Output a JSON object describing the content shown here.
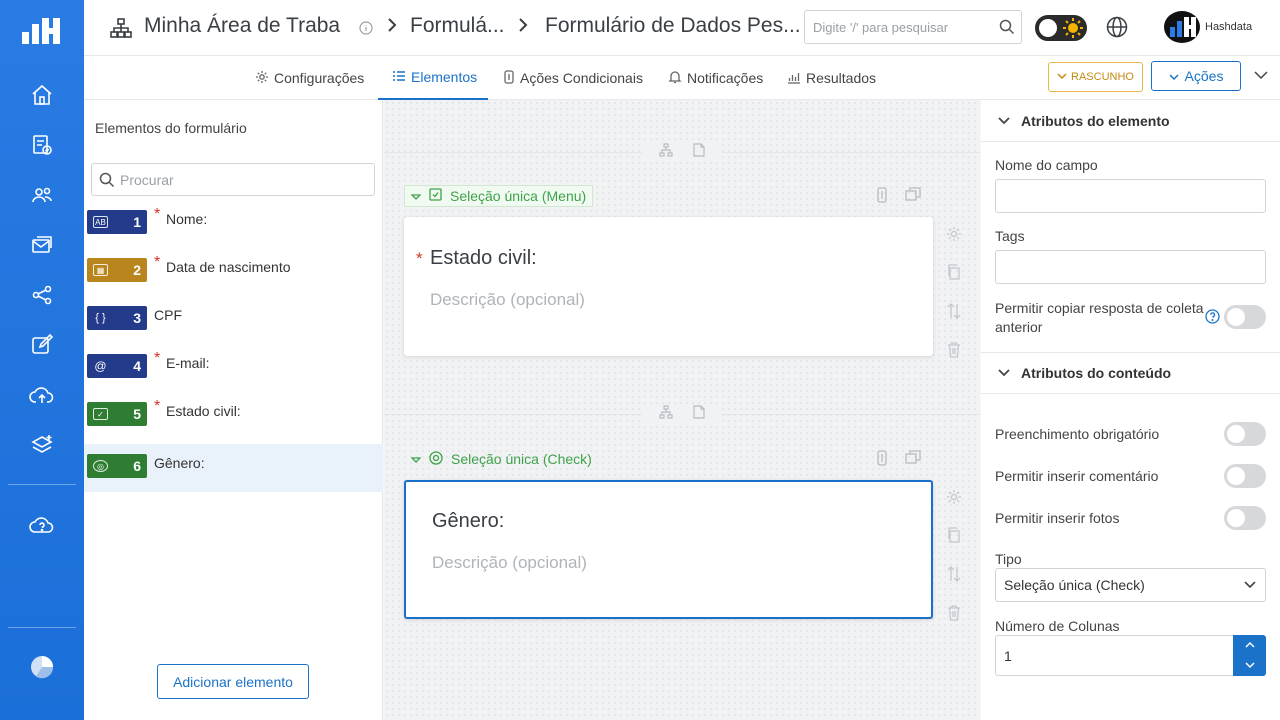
{
  "topbar": {
    "workspace": "Minha Área de Traba",
    "crumb_1": "Formulá...",
    "crumb_2": "Formulário de Dados Pes...",
    "search_placeholder": "Digite '/' para pesquisar",
    "user_name": "Hashdata"
  },
  "tabs": [
    {
      "label": "Configurações",
      "icon": "gear-icon"
    },
    {
      "label": "Elementos",
      "icon": "list-icon"
    },
    {
      "label": "Ações Condicionais",
      "icon": "conditional-icon"
    },
    {
      "label": "Notificações",
      "icon": "bell-icon"
    },
    {
      "label": "Resultados",
      "icon": "chart-icon"
    }
  ],
  "toolbar": {
    "draft_label": "RASCUNHO",
    "actions_label": "Ações"
  },
  "left_panel": {
    "title": "Elementos do formulário",
    "search_placeholder": "Procurar",
    "add_button": "Adicionar elemento",
    "elements": [
      {
        "number": "1",
        "label": "Nome:",
        "required": true,
        "color": "#243a8a",
        "icon": "AB"
      },
      {
        "number": "2",
        "label": "Data de nascimento",
        "required": true,
        "color": "#b8861c",
        "icon": "▦"
      },
      {
        "number": "3",
        "label": "CPF",
        "required": false,
        "color": "#243a8a",
        "icon": "{ }"
      },
      {
        "number": "4",
        "label": "E-mail:",
        "required": true,
        "color": "#243a8a",
        "icon": "@"
      },
      {
        "number": "5",
        "label": "Estado civil:",
        "required": true,
        "color": "#2e7d32",
        "icon": "✓"
      },
      {
        "number": "6",
        "label": "Gênero:",
        "required": false,
        "color": "#2e7d32",
        "icon": "◎"
      }
    ]
  },
  "canvas": {
    "card_1": {
      "type": "Seleção única (Menu)",
      "title": "Estado civil:",
      "description": "Descrição (opcional)"
    },
    "card_2": {
      "type": "Seleção única (Check)",
      "title": "Gênero:",
      "description": "Descrição (opcional)"
    }
  },
  "right_panel": {
    "section_1": "Atributos do elemento",
    "field_name_label": "Nome do campo",
    "field_name_value": "",
    "tags_label": "Tags",
    "tags_value": "",
    "copy_previous_label": "Permitir copiar resposta de coleta anterior",
    "section_2": "Atributos do conteúdo",
    "required_label": "Preenchimento obrigatório",
    "comment_label": "Permitir inserir comentário",
    "photos_label": "Permitir inserir fotos",
    "type_label": "Tipo",
    "type_value": "Seleção única (Check)",
    "columns_label": "Número de Colunas",
    "columns_value": "1"
  },
  "colors": {
    "sidebar": "#1b6fd8",
    "accent": "#1a73c9",
    "draft": "#e8b84a",
    "required": "#d9342b"
  }
}
